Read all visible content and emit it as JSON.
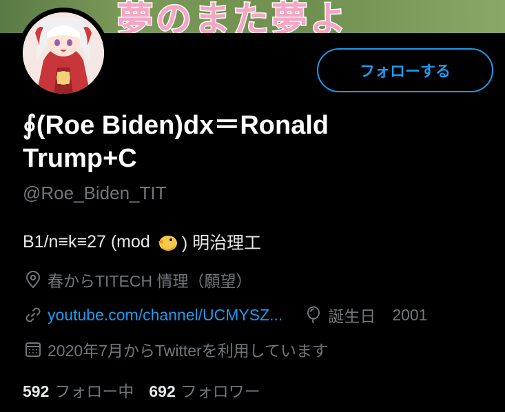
{
  "banner": {
    "text": "夢のまた夢よ"
  },
  "profile": {
    "name": "∮(Roe Biden)dx＝Ronald Trump+C",
    "handle": "@Roe_Biden_TIT",
    "bio_prefix": "B1/n≡k≡27 (mod",
    "bio_suffix": ") 明治理工",
    "location": "春からTITECH 情理（願望）",
    "website": "youtube.com/channel/UCMYSZ...",
    "birthday_label": "誕生日",
    "birthday_year": "2001",
    "joined": "2020年7月からTwitterを利用しています"
  },
  "actions": {
    "follow_label": "フォローする"
  },
  "stats": {
    "following_count": "592",
    "following_label": "フォロー中",
    "followers_count": "692",
    "followers_label": "フォロワー"
  },
  "colors": {
    "accent": "#1d9bf0",
    "muted": "#71767b",
    "background": "#000000"
  },
  "icons": [
    "location-icon",
    "link-icon",
    "birthday-balloon-icon",
    "calendar-icon",
    "chick-emoji"
  ]
}
